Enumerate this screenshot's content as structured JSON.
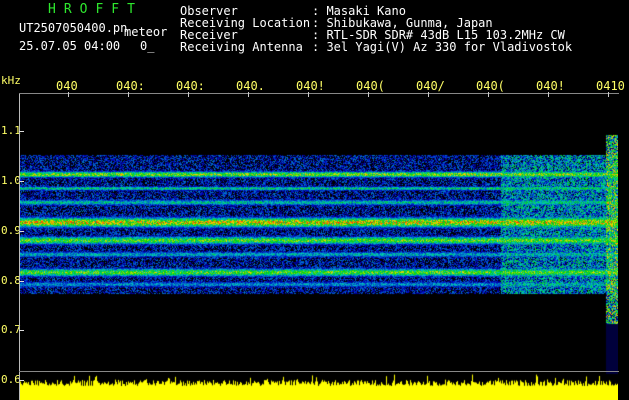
{
  "header": {
    "brand": "HROFFT",
    "filename": "UT2507050400.pn",
    "meteor_label": "meteor",
    "datetime": "25.07.05 04:00",
    "count": "0_",
    "fields": [
      {
        "label": "Observer",
        "value": ": Masaki Kano"
      },
      {
        "label": "Receiving Location",
        "value": ": Shibukawa, Gunma, Japan"
      },
      {
        "label": "Receiver",
        "value": ": RTL-SDR SDR# 43dB L15 103.2MHz CW"
      },
      {
        "label": "Receiving Antenna",
        "value": ": 3el Yagi(V) Az 330 for Vladivostok"
      }
    ]
  },
  "axis": {
    "unit": "kHz",
    "y_ticks": [
      "1.1",
      "1.0",
      "0.9",
      "0.8",
      "0.7",
      "0.6"
    ],
    "time_ticks": [
      "040",
      "040:",
      "040:",
      "040.",
      "040!",
      "040(",
      "040/",
      "040(",
      "040!",
      "0410"
    ]
  },
  "colors": {
    "background": "#000000",
    "text": "#ffffff",
    "brand": "#2ee82e",
    "axis_labels": "#ffff66",
    "noise_band": "#ffff00"
  }
}
